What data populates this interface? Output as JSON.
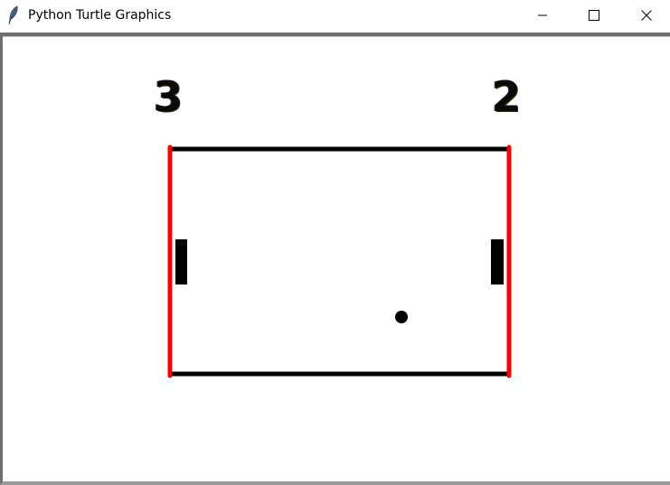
{
  "window": {
    "title": "Python Turtle Graphics",
    "icon": "feather-icon",
    "controls": [
      "minimize-icon",
      "maximize-icon",
      "close-icon"
    ]
  },
  "game": {
    "score_left": "3",
    "score_right": "2",
    "colors": {
      "court_top_bottom": "#000000",
      "court_sides": "#ff0000",
      "paddles": "#000000",
      "ball": "#000000",
      "background": "#ffffff"
    }
  }
}
